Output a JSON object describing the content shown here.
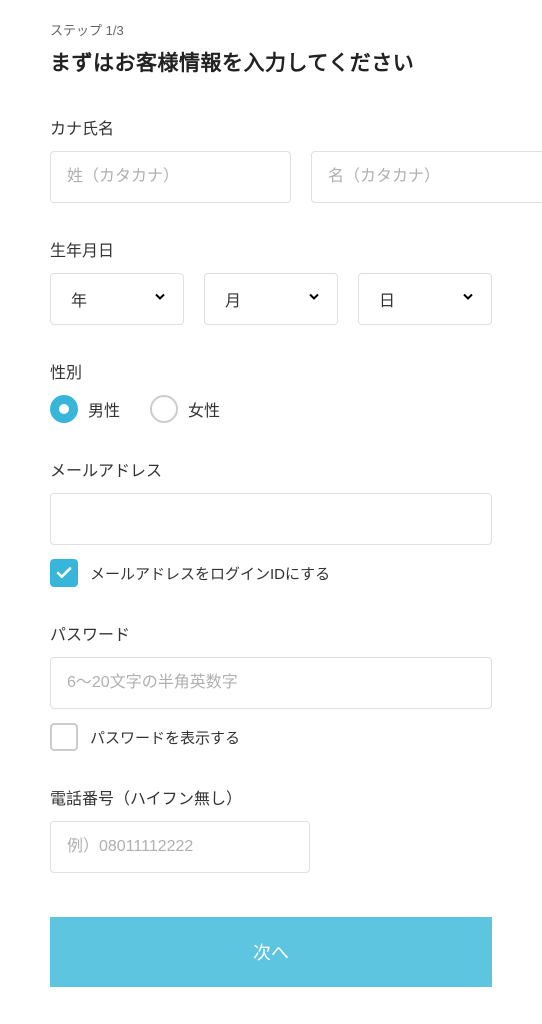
{
  "step": "ステップ  1/3",
  "title": "まずはお客様情報を入力してください",
  "name": {
    "label": "カナ氏名",
    "surname_placeholder": "姓（カタカナ）",
    "firstname_placeholder": "名（カタカナ）"
  },
  "birthdate": {
    "label": "生年月日",
    "year": "年",
    "month": "月",
    "day": "日"
  },
  "gender": {
    "label": "性別",
    "male": "男性",
    "female": "女性"
  },
  "email": {
    "label": "メールアドレス",
    "checkbox_label": "メールアドレスをログインIDにする"
  },
  "password": {
    "label": "パスワード",
    "placeholder": "6〜20文字の半角英数字",
    "show_label": "パスワードを表示する"
  },
  "phone": {
    "label": "電話番号（ハイフン無し）",
    "placeholder": "例）08011112222"
  },
  "next_button": "次へ"
}
